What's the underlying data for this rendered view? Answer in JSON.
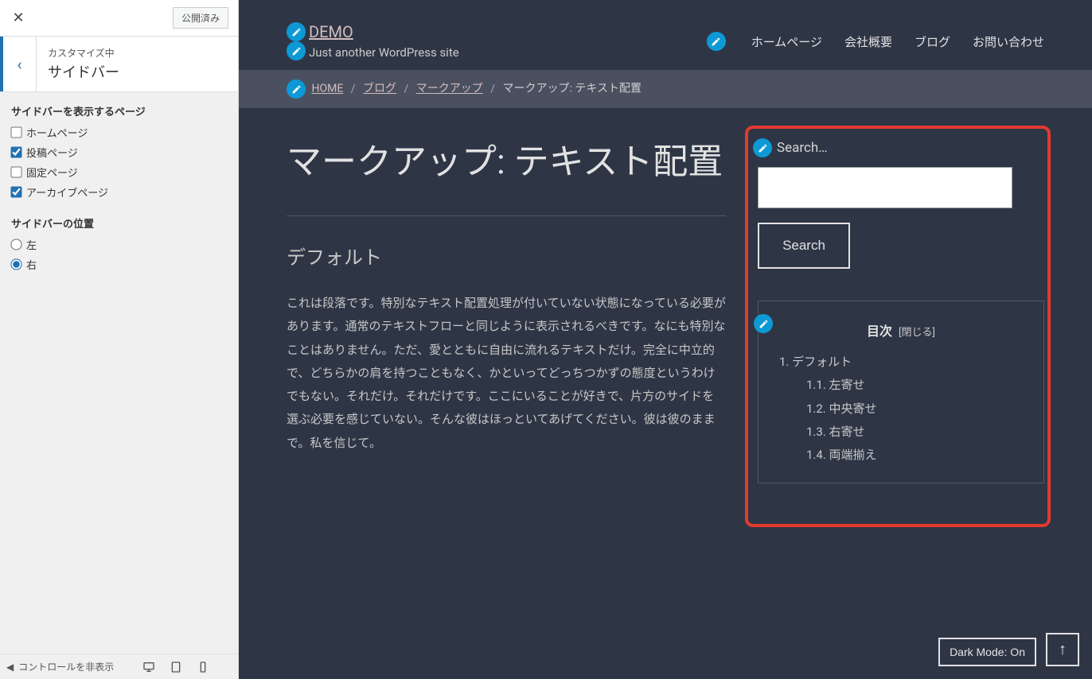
{
  "customizer": {
    "publish_label": "公開済み",
    "subtitle": "カスタマイズ中",
    "title": "サイドバー",
    "hide_controls": "コントロールを非表示",
    "groups": {
      "pages": {
        "label": "サイドバーを表示するページ",
        "home": "ホームページ",
        "posts": "投稿ページ",
        "fixed": "固定ページ",
        "archive": "アーカイブページ"
      },
      "position": {
        "label": "サイドバーの位置",
        "left": "左",
        "right": "右"
      }
    }
  },
  "site": {
    "title": "DEMO",
    "tagline": "Just another WordPress site"
  },
  "nav": {
    "home": "ホームページ",
    "about": "会社概要",
    "blog": "ブログ",
    "contact": "お問い合わせ"
  },
  "breadcrumb": {
    "home": "HOME",
    "blog": "ブログ",
    "cat": "マークアップ",
    "current": "マークアップ: テキスト配置"
  },
  "page": {
    "title": "マークアップ: テキスト配置",
    "h2_default": "デフォルト",
    "para": "これは段落です。特別なテキスト配置処理が付いていない状態になっている必要があります。通常のテキストフローと同じように表示されるべきです。なにも特別なことはありません。ただ、愛とともに自由に流れるテキストだけ。完全に中立的で、どちらかの肩を持つこともなく、かといってどっちつかずの態度というわけでもない。それだけ。それだけです。ここにいることが好きで、片方のサイドを選ぶ必要を感じていない。そんな彼はほっといてあげてください。彼は彼のままで。私を信じて。"
  },
  "widgets": {
    "search_label": "Search…",
    "search_button": "Search",
    "toc": {
      "title": "目次",
      "toggle": "[閉じる]",
      "i1": "1. デフォルト",
      "i11": "1.1. 左寄せ",
      "i12": "1.2. 中央寄せ",
      "i13": "1.3. 右寄せ",
      "i14": "1.4. 両端揃え"
    }
  },
  "buttons": {
    "dark_mode": "Dark Mode: On"
  }
}
